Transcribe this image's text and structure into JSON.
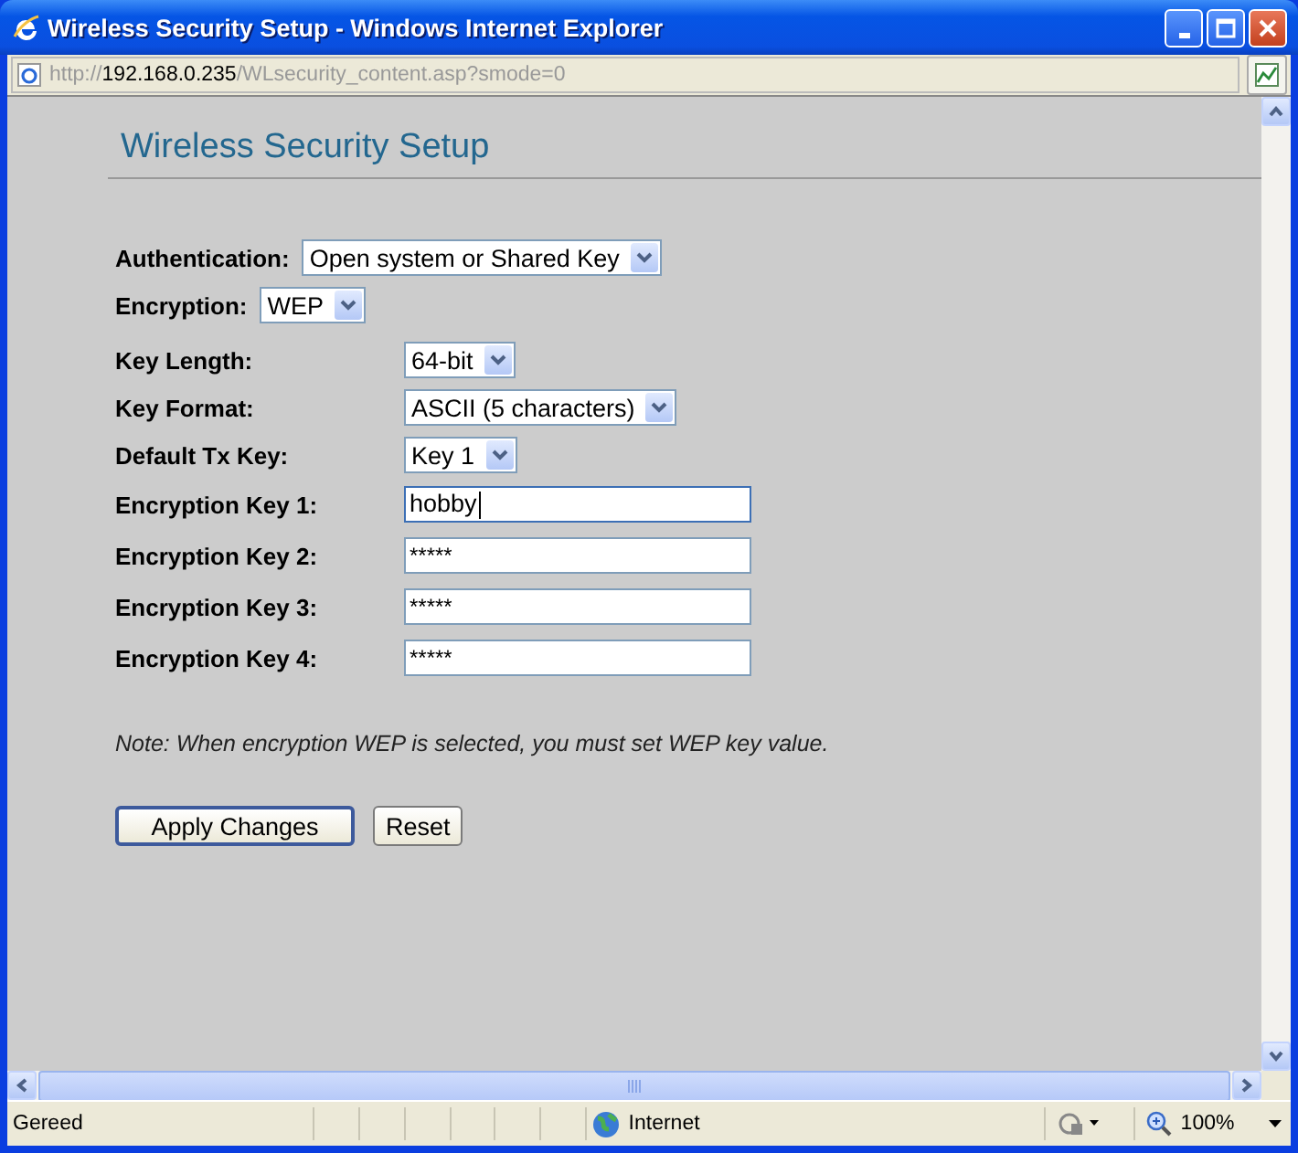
{
  "window": {
    "title": "Wireless Security Setup - Windows Internet Explorer"
  },
  "address_bar": {
    "scheme": "http://",
    "host": "192.168.0.235",
    "path": "/WLsecurity_content.asp?smode=0"
  },
  "page": {
    "heading": "Wireless Security Setup",
    "inline_fields": [
      {
        "label": "Authentication:",
        "value": "Open system or Shared Key"
      },
      {
        "label": "Encryption:",
        "value": "WEP"
      }
    ],
    "fields": [
      {
        "label": "Key Length:",
        "kind": "select",
        "value": "64-bit"
      },
      {
        "label": "Key Format:",
        "kind": "select",
        "value": "ASCII (5 characters)"
      },
      {
        "label": "Default Tx Key:",
        "kind": "select",
        "value": "Key 1"
      },
      {
        "label": "Encryption Key 1:",
        "kind": "text",
        "value": "hobby",
        "focused": true
      },
      {
        "label": "Encryption Key 2:",
        "kind": "text",
        "value": "*****",
        "focused": false
      },
      {
        "label": "Encryption Key 3:",
        "kind": "text",
        "value": "*****",
        "focused": false
      },
      {
        "label": "Encryption Key 4:",
        "kind": "text",
        "value": "*****",
        "focused": false
      }
    ],
    "note": "Note: When encryption WEP is selected, you must set WEP key value.",
    "buttons": [
      {
        "label": "Apply Changes",
        "default": true
      },
      {
        "label": "Reset",
        "default": false
      }
    ]
  },
  "status_bar": {
    "text": "Gereed",
    "zone": "Internet",
    "zoom": "100%"
  }
}
